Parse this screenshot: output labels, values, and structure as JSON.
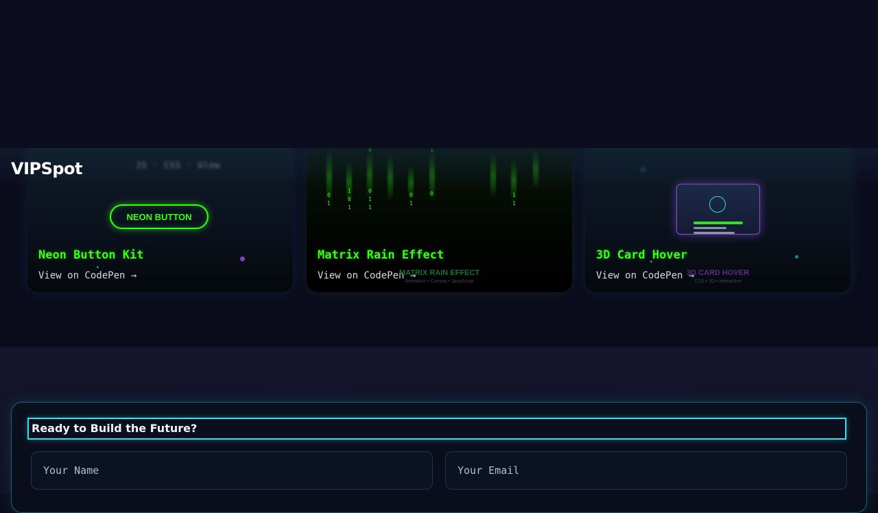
{
  "brand": {
    "logo": "VIPSpot",
    "blurred_text": "JS · CSS · Glow"
  },
  "cards": [
    {
      "title": "Neon Button Kit",
      "link": "View on CodePen →",
      "demo_button": "NEON BUTTON"
    },
    {
      "title": "Matrix Rain Effect",
      "link": "View on CodePen →",
      "overlay_title": "MATRIX RAIN EFFECT",
      "overlay_sub": "Animation • Canvas • JavaScript",
      "digits": [
        "0",
        "1",
        "1",
        "0",
        "1",
        "0",
        "1",
        "1",
        "0",
        "1",
        "0",
        "1",
        "1",
        "0",
        "1"
      ]
    },
    {
      "title": "3D Card Hover",
      "link": "View on CodePen →",
      "overlay_title": "3D CARD HOVER",
      "overlay_sub": "CSS • 3D • Interactive"
    }
  ],
  "contact": {
    "title": "Ready to Build the Future?",
    "name_placeholder": "Your Name",
    "email_placeholder": "Your Email"
  },
  "colors": {
    "neon_green": "#39ff14",
    "cyan": "#33e0f0",
    "purple": "#8a4fd0",
    "background": "#0b0c1b"
  }
}
